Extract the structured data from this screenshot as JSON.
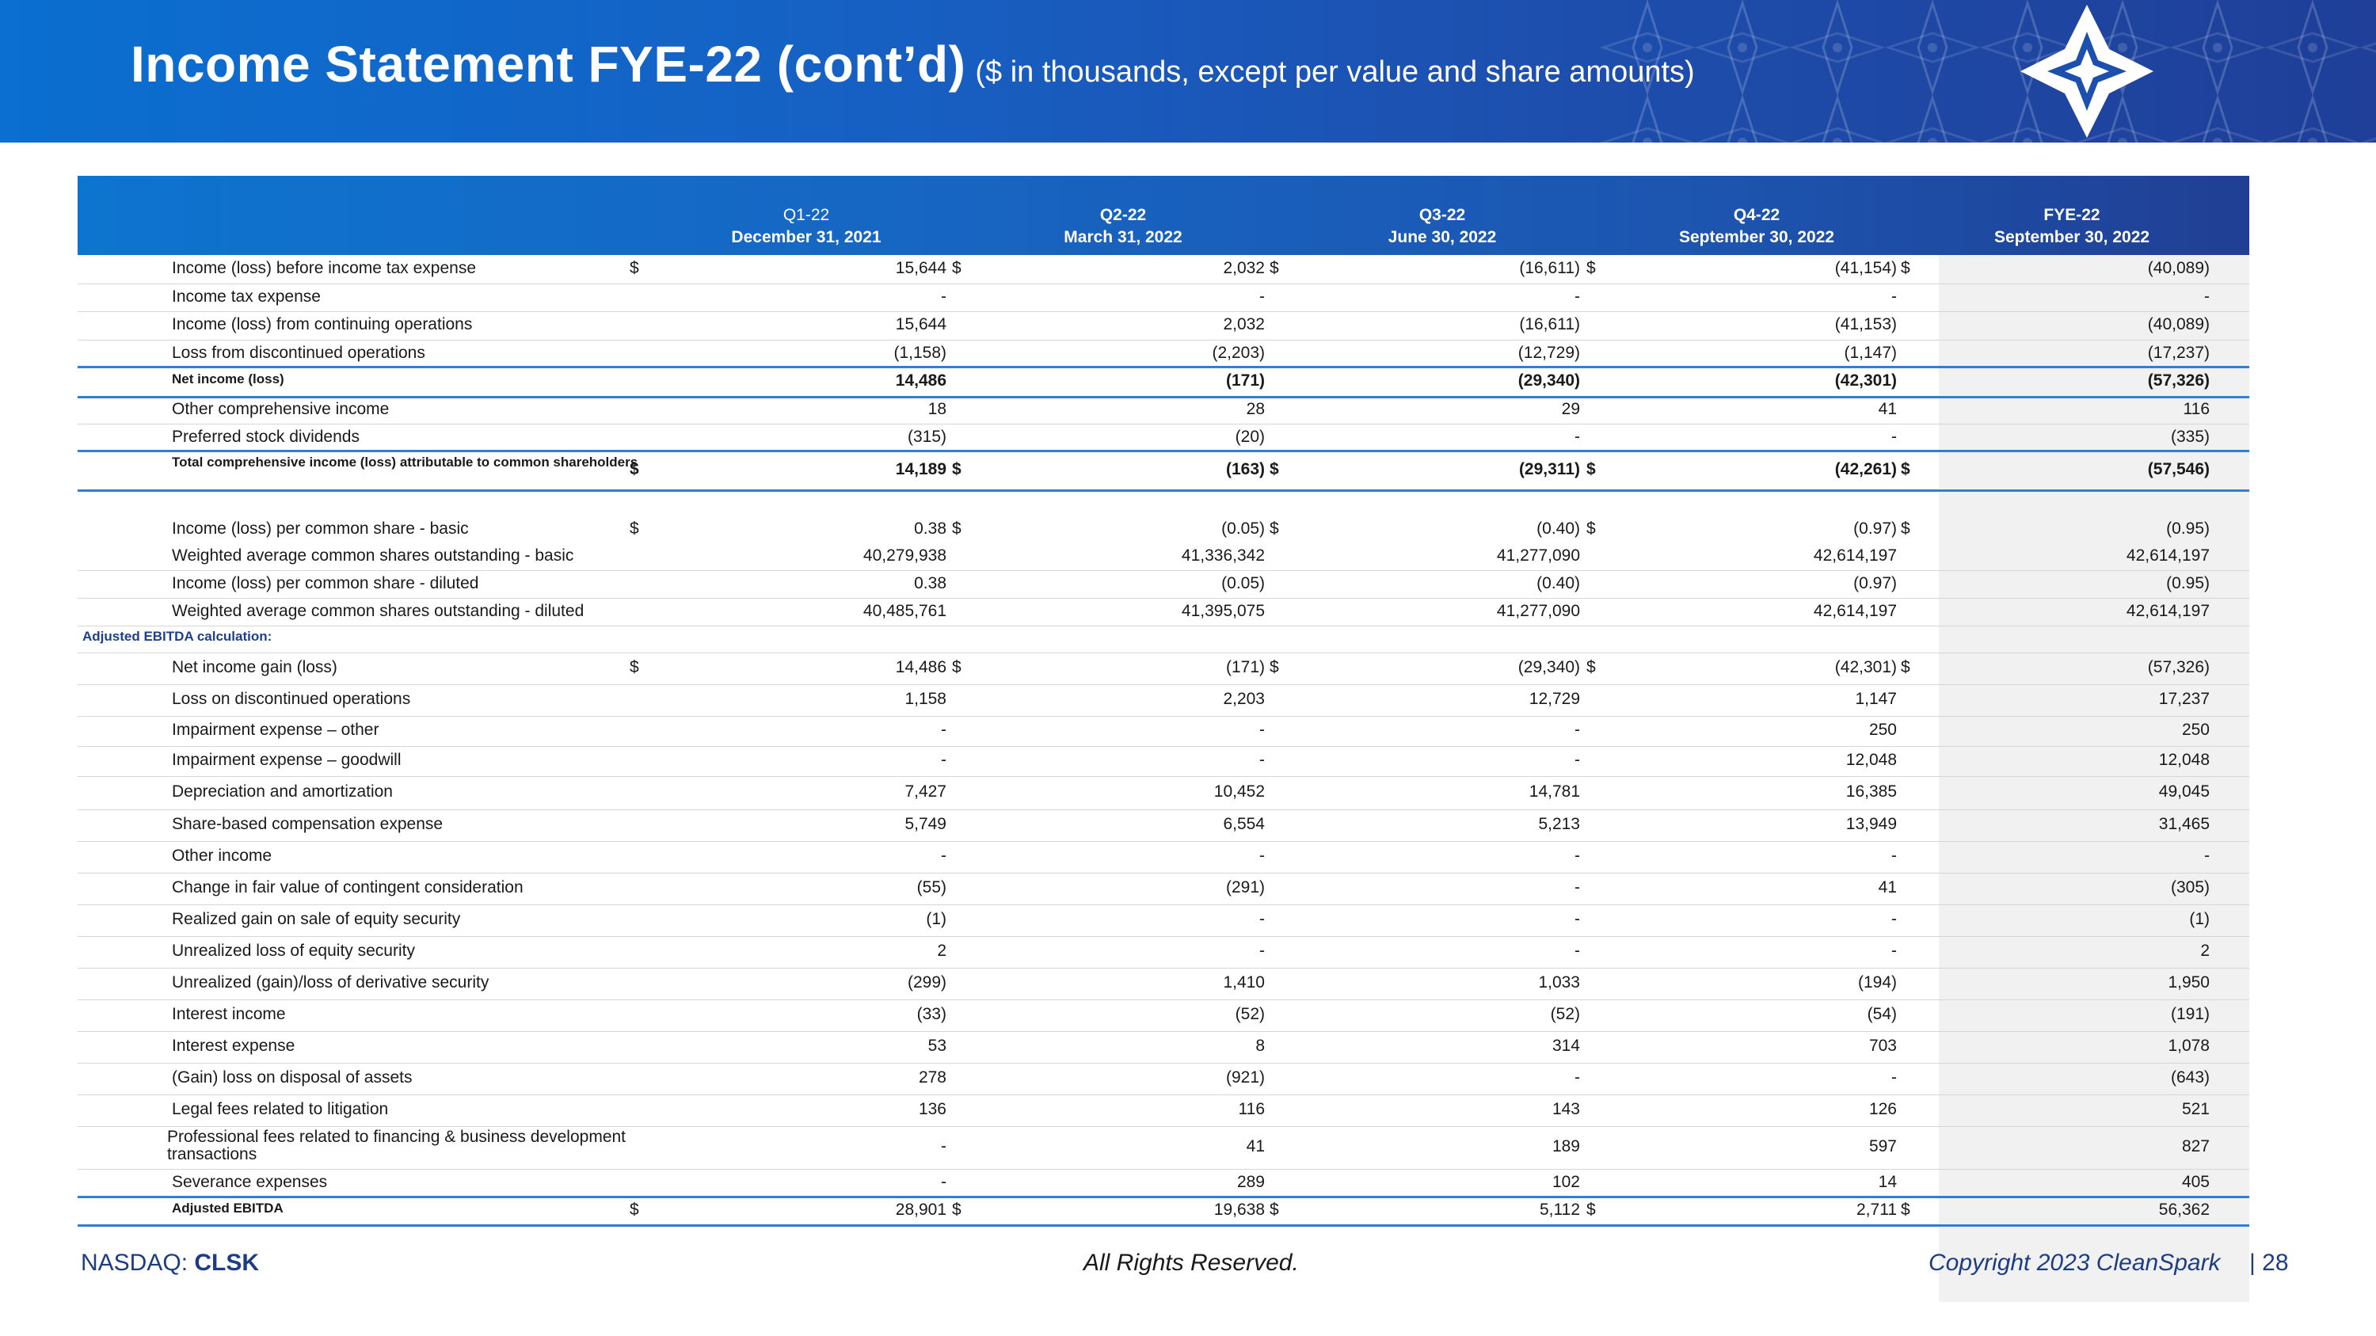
{
  "title": {
    "main": "Income Statement FYE-22 (cont’d)",
    "sub": "($ in thousands, except per value and share amounts)"
  },
  "colors": {
    "banner_start": "#0a6fd0",
    "banner_end": "#1f3f98",
    "accent_line": "#2f7fd4",
    "section_text": "#1d3f8f",
    "footer_text": "#1c3d86"
  },
  "columns": [
    {
      "period": "Q1-22",
      "date": "December 31, 2021"
    },
    {
      "period": "Q2-22",
      "date": "March 31, 2022"
    },
    {
      "period": "Q3-22",
      "date": "June 30, 2022"
    },
    {
      "period": "Q4-22",
      "date": "September 30, 2022"
    },
    {
      "period": "FYE-22",
      "date": "September 30, 2022"
    }
  ],
  "rows": [
    {
      "label": "Income (loss) before income tax expense",
      "dollar": true,
      "values": [
        "15,644",
        "2,032",
        "(16,611)",
        "(41,154)",
        "(40,089)"
      ]
    },
    {
      "label": "Income tax expense",
      "values": [
        "-",
        "-",
        "-",
        "-",
        "-"
      ]
    },
    {
      "label": "Income (loss) from continuing operations",
      "values": [
        "15,644",
        "2,032",
        "(16,611)",
        "(41,153)",
        "(40,089)"
      ]
    },
    {
      "label": "Loss from discontinued operations",
      "values": [
        "(1,158)",
        "(2,203)",
        "(12,729)",
        "(1,147)",
        "(17,237)"
      ]
    },
    {
      "label": "Net income (loss)",
      "values": [
        "14,486",
        "(171)",
        "(29,340)",
        "(42,301)",
        "(57,326)"
      ]
    },
    {
      "label": "Other comprehensive income",
      "values": [
        "18",
        "28",
        "29",
        "41",
        "116"
      ]
    },
    {
      "label": "Preferred stock dividends",
      "values": [
        "(315)",
        "(20)",
        "-",
        "-",
        "(335)"
      ]
    },
    {
      "label": "Total comprehensive income (loss) attributable to common shareholders",
      "dollar": true,
      "values": [
        "14,189",
        "(163)",
        "(29,311)",
        "(42,261)",
        "(57,546)"
      ]
    },
    {
      "label": "Income (loss) per common share - basic",
      "dollar": true,
      "values": [
        "0.38",
        "(0.05)",
        "(0.40)",
        "(0.97)",
        "(0.95)"
      ]
    },
    {
      "label": "Weighted average common shares outstanding - basic",
      "values": [
        "40,279,938",
        "41,336,342",
        "41,277,090",
        "42,614,197",
        "42,614,197"
      ]
    },
    {
      "label": "Income (loss) per common share - diluted",
      "values": [
        "0.38",
        "(0.05)",
        "(0.40)",
        "(0.97)",
        "(0.95)"
      ]
    },
    {
      "label": "Weighted average common shares outstanding - diluted",
      "values": [
        "40,485,761",
        "41,395,075",
        "41,277,090",
        "42,614,197",
        "42,614,197"
      ]
    },
    {
      "label": "Adjusted EBITDA calculation:",
      "values": [
        "",
        "",
        "",
        "",
        ""
      ]
    },
    {
      "label": "Net income gain (loss)",
      "dollar": true,
      "values": [
        "14,486",
        "(171)",
        "(29,340)",
        "(42,301)",
        "(57,326)"
      ]
    },
    {
      "label": "Loss on discontinued operations",
      "values": [
        "1,158",
        "2,203",
        "12,729",
        "1,147",
        "17,237"
      ]
    },
    {
      "label": "Impairment expense – other",
      "values": [
        "-",
        "-",
        "-",
        "250",
        "250"
      ]
    },
    {
      "label": "Impairment expense – goodwill",
      "values": [
        "-",
        "-",
        "-",
        "12,048",
        "12,048"
      ]
    },
    {
      "label": "Depreciation and amortization",
      "values": [
        "7,427",
        "10,452",
        "14,781",
        "16,385",
        "49,045"
      ]
    },
    {
      "label": "Share-based compensation expense",
      "values": [
        "5,749",
        "6,554",
        "5,213",
        "13,949",
        "31,465"
      ]
    },
    {
      "label": "Other income",
      "values": [
        "-",
        "-",
        "-",
        "-",
        "-"
      ]
    },
    {
      "label": "Change in fair value of contingent consideration",
      "values": [
        "(55)",
        "(291)",
        "-",
        "41",
        "(305)"
      ]
    },
    {
      "label": "Realized gain on sale of equity security",
      "values": [
        "(1)",
        "-",
        "-",
        "-",
        "(1)"
      ]
    },
    {
      "label": "Unrealized loss of equity security",
      "values": [
        "2",
        "-",
        "-",
        "-",
        "2"
      ]
    },
    {
      "label": "Unrealized (gain)/loss of derivative security",
      "values": [
        "(299)",
        "1,410",
        "1,033",
        "(194)",
        "1,950"
      ]
    },
    {
      "label": "Interest income",
      "values": [
        "(33)",
        "(52)",
        "(52)",
        "(54)",
        "(191)"
      ]
    },
    {
      "label": "Interest expense",
      "values": [
        "53",
        "8",
        "314",
        "703",
        "1,078"
      ]
    },
    {
      "label": "(Gain) loss on disposal of assets",
      "values": [
        "278",
        "(921)",
        "-",
        "-",
        "(643)"
      ]
    },
    {
      "label": "Legal fees related to litigation",
      "values": [
        "136",
        "116",
        "143",
        "126",
        "521"
      ]
    },
    {
      "label": "Professional fees related to financing & business development transactions",
      "values": [
        "-",
        "41",
        "189",
        "597",
        "827"
      ]
    },
    {
      "label": "Severance expenses",
      "values": [
        "-",
        "289",
        "102",
        "14",
        "405"
      ]
    },
    {
      "label": "Adjusted EBITDA",
      "dollar": true,
      "values": [
        "28,901",
        "19,638",
        "5,112",
        "2,711",
        "56,362"
      ]
    }
  ],
  "dollar_sign": "$",
  "footer": {
    "exchange_prefix": "NASDAQ:",
    "ticker": "CLSK",
    "rights": "All Rights Reserved.",
    "copyright": "Copyright 2023 CleanSpark",
    "page": "|  28"
  },
  "icons": {
    "logo": "cleanspark-star-logo",
    "pattern": "diamond-pattern"
  }
}
